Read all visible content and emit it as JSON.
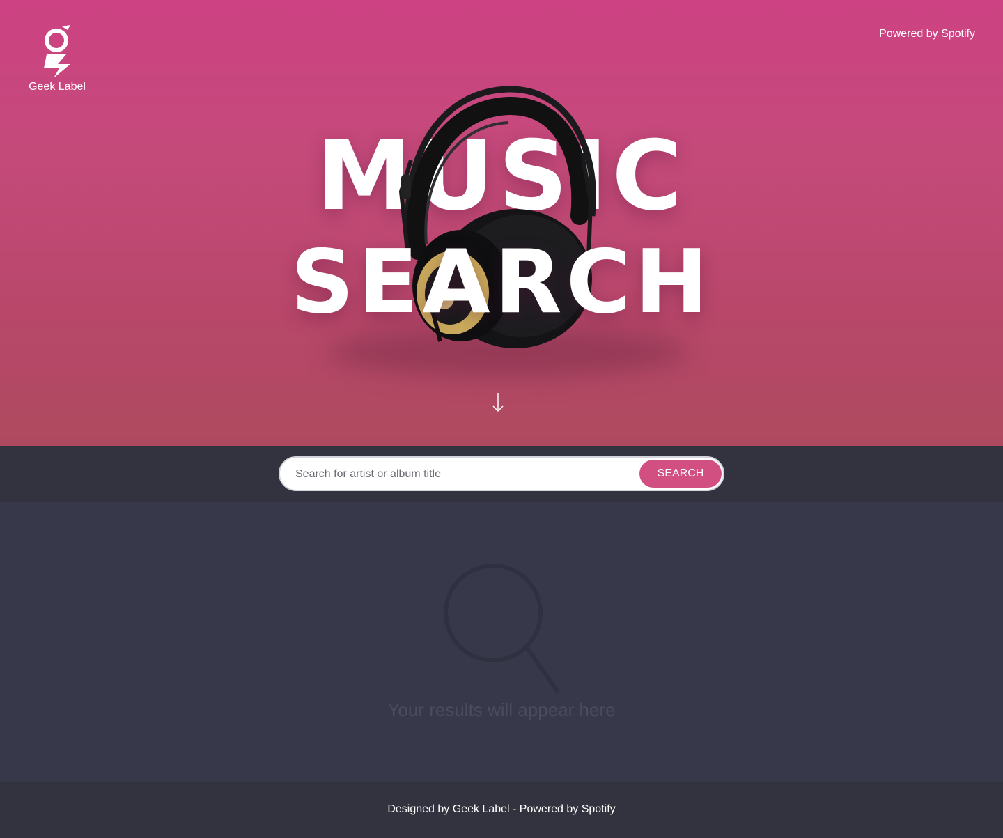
{
  "header": {
    "brand_name": "Geek Label",
    "powered_by": "Powered by Spotify"
  },
  "hero": {
    "title_line1": "MUSIC",
    "title_line2": "SEARCH",
    "scroll_icon": "arrow-down-icon",
    "image": "headphones-icon"
  },
  "search": {
    "placeholder": "Search for artist or album title",
    "value": "",
    "button_label": "SEARCH"
  },
  "results": {
    "icon": "search-icon",
    "empty_message": "Your results will appear here"
  },
  "footer": {
    "text": "Designed by Geek Label - Powered by Spotify"
  },
  "colors": {
    "hero_top": "#cd4283",
    "hero_bottom": "#ae4a5f",
    "search_bar_bg": "#32333f",
    "results_bg": "#373849",
    "footer_bg": "#32333f",
    "accent": "#d14f81"
  }
}
